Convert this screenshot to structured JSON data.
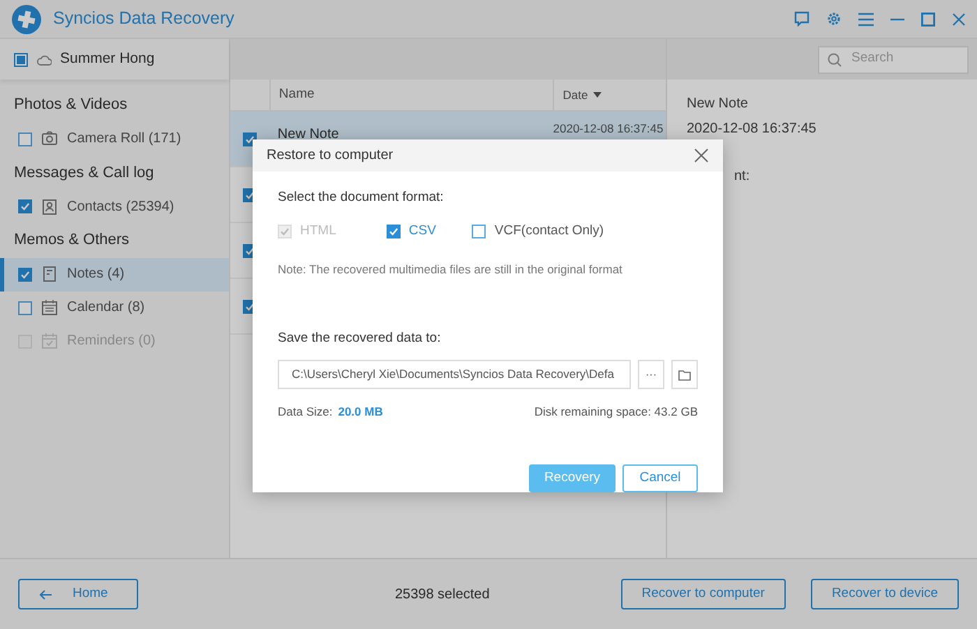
{
  "window": {
    "title": "Syncios Data Recovery"
  },
  "device": {
    "name": "Summer Hong",
    "indeterminate": true
  },
  "sidebar": {
    "groups": [
      {
        "title": "Photos & Videos",
        "items": [
          {
            "label": "Camera Roll (171)",
            "kind": "camera",
            "checked": false,
            "selected": false,
            "disabled": false
          }
        ]
      },
      {
        "title": "Messages & Call log",
        "items": [
          {
            "label": "Contacts (25394)",
            "kind": "contacts",
            "checked": true,
            "selected": false,
            "disabled": false
          }
        ]
      },
      {
        "title": "Memos & Others",
        "items": [
          {
            "label": "Notes (4)",
            "kind": "notes",
            "checked": true,
            "selected": true,
            "disabled": false
          },
          {
            "label": "Calendar (8)",
            "kind": "calendar",
            "checked": false,
            "selected": false,
            "disabled": false
          },
          {
            "label": "Reminders (0)",
            "kind": "reminders",
            "checked": false,
            "selected": false,
            "disabled": true
          }
        ]
      }
    ]
  },
  "search": {
    "placeholder": "Search"
  },
  "table": {
    "columns": [
      "Name",
      "Date"
    ],
    "rows": [
      {
        "name": "New Note",
        "date": "2020-12-08 16:37:45",
        "checked": true,
        "selected": true
      },
      {
        "checked": true,
        "selected": false
      },
      {
        "checked": true,
        "selected": false
      },
      {
        "checked": true,
        "selected": false
      }
    ]
  },
  "detail": {
    "title": "New Note",
    "date": "2020-12-08 16:37:45",
    "content_label": "nt:"
  },
  "dialog": {
    "title": "Restore to computer",
    "format_label": "Select the document format:",
    "formats": [
      {
        "label": "HTML",
        "checked": true,
        "disabled": true
      },
      {
        "label": "CSV",
        "checked": true,
        "disabled": false
      },
      {
        "label": "VCF(contact Only)",
        "checked": false,
        "disabled": false
      }
    ],
    "note": "Note: The recovered multimedia files are still in the original format",
    "save_label": "Save the recovered data to:",
    "path": "C:\\Users\\Cheryl Xie\\Documents\\Syncios Data Recovery\\Defa",
    "browse_button": "···",
    "data_size_label": "Data Size:",
    "data_size_value": "20.0 MB",
    "disk_space": "Disk remaining space: 43.2 GB",
    "buttons": [
      {
        "label": "Recovery",
        "kind": "primary"
      },
      {
        "label": "Cancel",
        "kind": "outline"
      }
    ]
  },
  "footer": {
    "home_button": "Home",
    "selected_count": "25398 selected",
    "buttons": [
      "Recover to computer",
      "Recover to device"
    ]
  }
}
